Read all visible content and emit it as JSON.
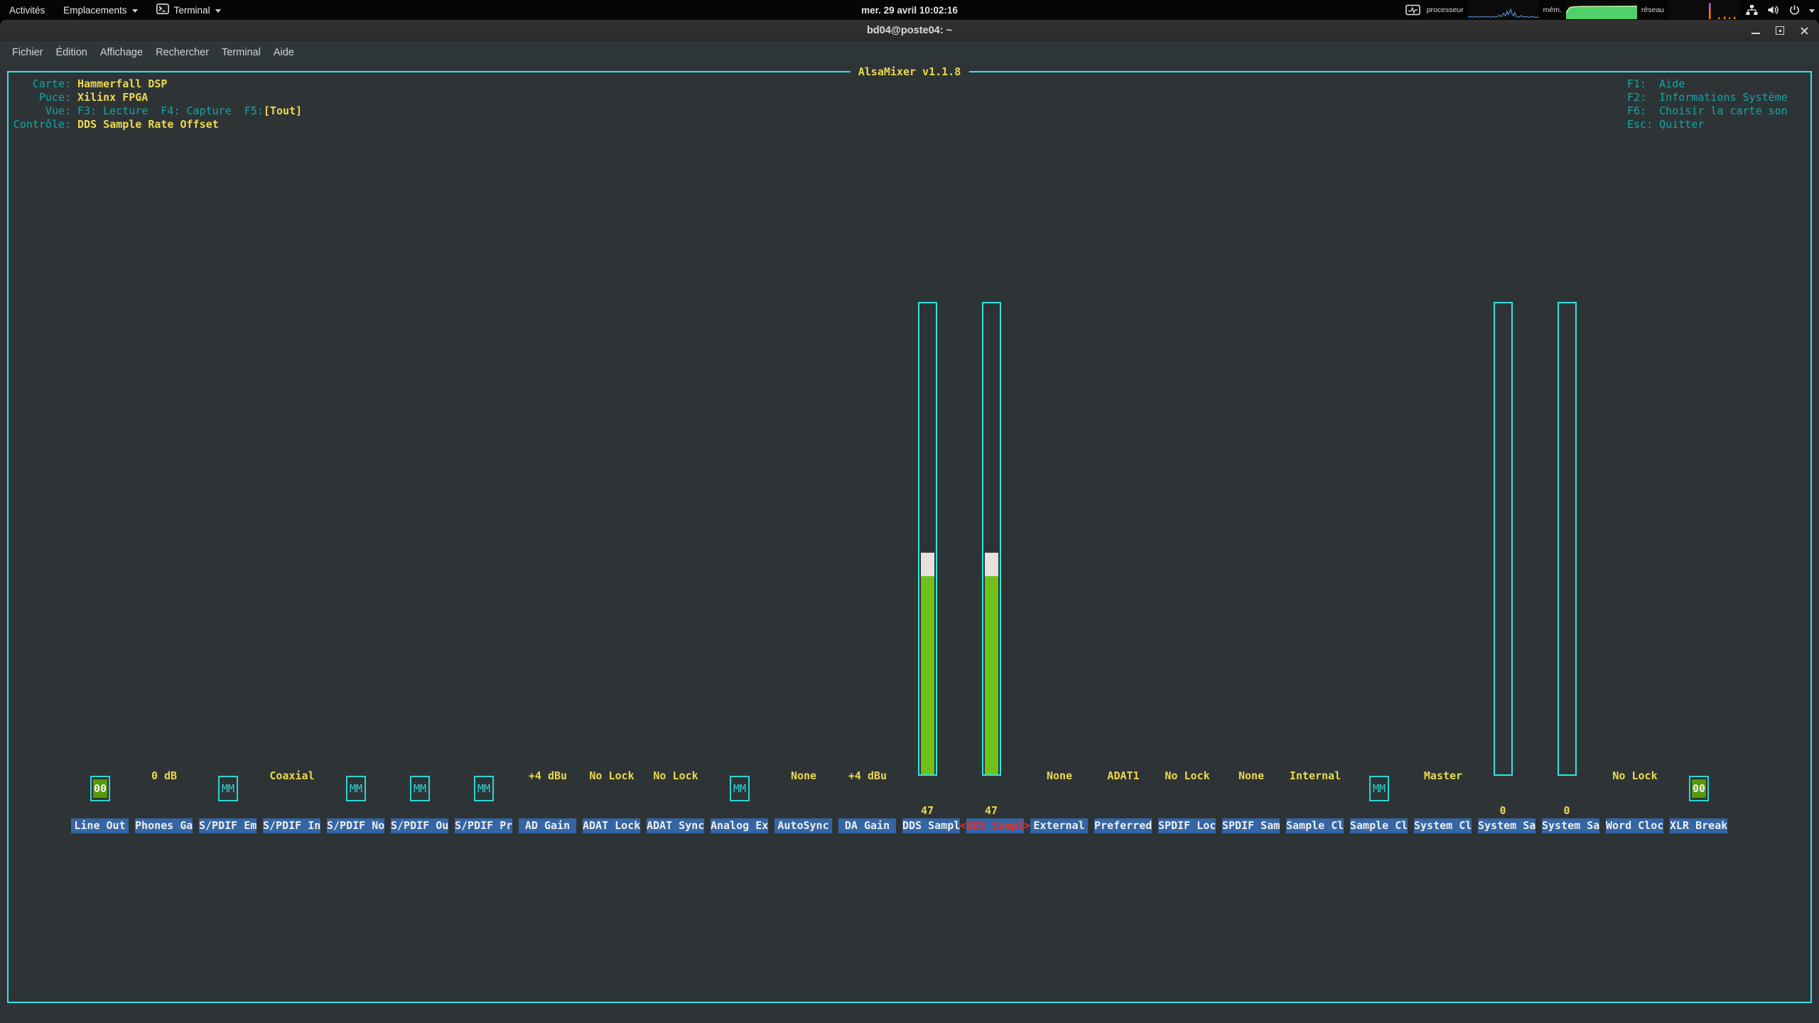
{
  "topbar": {
    "activities_label": "Activités",
    "places_label": "Emplacements",
    "terminal_menu_label": "Terminal",
    "clock": "mer. 29 avril 10:02:16",
    "tray": {
      "cpu_label": "processeur",
      "mem_label": "mém.",
      "net_label": "réseau"
    }
  },
  "window": {
    "title": "bd04@poste04: ~"
  },
  "menubar": {
    "items": [
      "Fichier",
      "Édition",
      "Affichage",
      "Rechercher",
      "Terminal",
      "Aide"
    ]
  },
  "alsamixer": {
    "app_title": "AlsaMixer v1.1.8",
    "info": {
      "carte_label": "Carte:",
      "carte_value": "Hammerfall DSP",
      "puce_label": "Puce:",
      "puce_value": "Xilinx FPGA",
      "vue_label": "Vue:",
      "vue_keys": "F3: Lecture  F4: Capture  F5:",
      "vue_mode": "[Tout]",
      "controle_label": "Contrôle:",
      "controle_value": "DDS Sample Rate Offset"
    },
    "help_lines": [
      "F1:  Aide",
      "F2:  Informations Système",
      "F6:  Choisir la carte son",
      "Esc: Quitter"
    ],
    "selection_brackets": {
      "left": "<",
      "right": ">"
    },
    "columns": [
      {
        "label": "Line Out",
        "indicator": "box",
        "state": "00"
      },
      {
        "label": "Phones Ga",
        "indicator": "text",
        "value": "0 dB"
      },
      {
        "label": "S/PDIF Em",
        "indicator": "box",
        "state": "MM"
      },
      {
        "label": "S/PDIF In",
        "indicator": "text",
        "value": "Coaxial"
      },
      {
        "label": "S/PDIF No",
        "indicator": "box",
        "state": "MM"
      },
      {
        "label": "S/PDIF Ou",
        "indicator": "box",
        "state": "MM"
      },
      {
        "label": "S/PDIF Pr",
        "indicator": "box",
        "state": "MM"
      },
      {
        "label": "AD Gain",
        "indicator": "text",
        "value": "+4 dBu"
      },
      {
        "label": "ADAT Lock",
        "indicator": "text",
        "value": "No Lock"
      },
      {
        "label": "ADAT Sync",
        "indicator": "text",
        "value": "No Lock"
      },
      {
        "label": "Analog Ex",
        "indicator": "box",
        "state": "MM"
      },
      {
        "label": "AutoSync",
        "indicator": "text",
        "value": "None"
      },
      {
        "label": "DA Gain",
        "indicator": "text",
        "value": "+4 dBu"
      },
      {
        "label": "DDS Sampl",
        "indicator": "bar",
        "volume": 47
      },
      {
        "label": "DDS Sampl",
        "indicator": "bar",
        "volume": 47,
        "selected": true
      },
      {
        "label": "External",
        "indicator": "text",
        "value": "None"
      },
      {
        "label": "Preferred",
        "indicator": "text",
        "value": "ADAT1"
      },
      {
        "label": "SPDIF Loc",
        "indicator": "text",
        "value": "No Lock"
      },
      {
        "label": "SPDIF Sam",
        "indicator": "text",
        "value": "None"
      },
      {
        "label": "Sample Cl",
        "indicator": "text",
        "value": "Internal"
      },
      {
        "label": "Sample Cl",
        "indicator": "box",
        "state": "MM"
      },
      {
        "label": "System Cl",
        "indicator": "text",
        "value": "Master"
      },
      {
        "label": "System Sa",
        "indicator": "bar",
        "volume": 0
      },
      {
        "label": "System Sa",
        "indicator": "bar",
        "volume": 0
      },
      {
        "label": "Word Cloc",
        "indicator": "text",
        "value": "No Lock"
      },
      {
        "label": "XLR Break",
        "indicator": "box",
        "state": "00"
      }
    ],
    "palette": {
      "terminal_bg": "#2e3436",
      "frame_cyan": "#34e2e2",
      "text_cyan": "#0fa7a9",
      "value_yellow": "#edd84e",
      "label_bg_blue": "#3465a4",
      "label_fg": "#eeeeec",
      "selected_red": "#ea2c2c",
      "bar_green": "#70c21a",
      "bar_top_white": "#e4e2dd",
      "unmute_green": "#56990a"
    }
  }
}
